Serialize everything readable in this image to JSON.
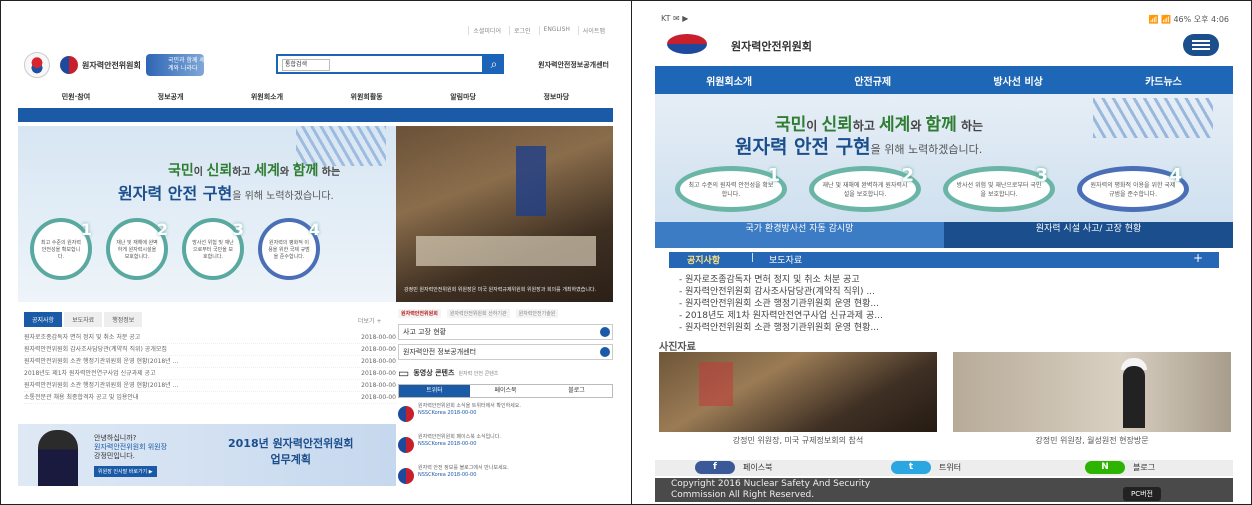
{
  "desktop": {
    "util_links": [
      "소셜미디어",
      "로그인",
      "ENGLISH",
      "사이트맵"
    ],
    "org_name": "원자력안전위원회",
    "slogan_logo": "국민과 함께 세계와 나라다",
    "search": {
      "select_value": "통합검색",
      "icon": "search-icon"
    },
    "side_link": "원자력안전정보공개센터",
    "gnb": [
      "민원·참여",
      "정보공개",
      "위원회소개",
      "위원회활동",
      "알림마당",
      "정보마당"
    ],
    "hero": {
      "line1_a": "국민",
      "line1_b": "이 ",
      "line1_c": "신뢰",
      "line1_d": "하고 ",
      "line1_e": "세계",
      "line1_f": "와 ",
      "line1_g": "함께",
      "line1_h": " 하는",
      "line2": "원자력 안전 구현",
      "line2_small": "을 위해 노력하겠습니다.",
      "circles": [
        {
          "num": "1",
          "text": "최고 수준의 원자력 안전성을 확보합니다."
        },
        {
          "num": "2",
          "text": "재난 및 재해에 완벽하게 원자력시설을 보호합니다."
        },
        {
          "num": "3",
          "text": "방사선 위험 및 재난으로부터 국민을 보호합니다."
        },
        {
          "num": "4",
          "text": "원자력의 평화적 이용을 위한 국제 규범을 준수합니다."
        }
      ]
    },
    "photo_caption": "강정민 원자력안전위원회 위원장은 미국 원자력규제위원회 위원장과 회의를 개최하였습니다.",
    "tabs": [
      "공지사항",
      "보도자료",
      "행정정보"
    ],
    "more": "더보기 +",
    "notices": [
      {
        "title": "원자로조종감독자 면허 정지 및 취소 처분 공고",
        "date": "2018-00-00"
      },
      {
        "title": "원자력안전위원회 감사조사담당관(계약직 직위) 공개모집",
        "date": "2018-00-00"
      },
      {
        "title": "원자력안전위원회 소관 행정기관위원회 운영 현황(2018년 ...",
        "date": "2018-00-00"
      },
      {
        "title": "2018년도 제1차 원자력안전연구사업 신규과제 공고",
        "date": "2018-00-00"
      },
      {
        "title": "원자력안전위원회 소관 행정기관위원회 운영 현황(2018년 ...",
        "date": "2018-00-00"
      },
      {
        "title": "소통전문관 채용 최종합격자 공고 및 임용안내",
        "date": "2018-00-00"
      }
    ],
    "banner": {
      "greet": [
        "안녕하십니까?",
        "원자력안전위원회 위원장",
        "강정민입니다."
      ],
      "btn": "위원장 인사말 바로가기 ▶",
      "title_1": "2018년 원자력안전위원회",
      "title_2": "업무계획"
    },
    "partners": [
      "원자력안전위원회",
      "원자력안전위원회 산하기관",
      "원자력안전기술원"
    ],
    "side_links": [
      "사고 고장 현황",
      "원자력안전 정보공개센터"
    ],
    "media": {
      "title": "동영상 콘텐츠",
      "sub": "원자력 안전 콘텐츠"
    },
    "sns_tabs": [
      "트위터",
      "페이스북",
      "블로그"
    ],
    "sns_items": [
      {
        "text": "원자력안전위원회 소식을 트위터에서 확인하세요.",
        "meta": "NSSCKorea 2018-00-00"
      },
      {
        "text": "원자력안전위원회 페이스북 소식입니다.",
        "meta": "NSSCKorea 2018-00-00"
      },
      {
        "text": "원자력 안전 정보를 블로그에서 만나보세요.",
        "meta": "NSSCKorea 2018-00-00"
      }
    ]
  },
  "mobile": {
    "status_left": "KT ✉ ▶",
    "status_right": "📶 📶 46% 오후 4:06",
    "title": "원자력안전위원회",
    "nav": [
      "위원회소개",
      "안전규제",
      "방사선 비상",
      "카드뉴스"
    ],
    "hero": {
      "line1_a": "국민",
      "line1_b": "이 ",
      "line1_c": "신뢰",
      "line1_d": "하고 ",
      "line1_e": "세계",
      "line1_f": "와 ",
      "line1_g": "함께",
      "line1_h": " 하는",
      "line2": "원자력 안전 구현",
      "line2_small": "을 위해 노력하겠습니다.",
      "ovals": [
        {
          "num": "1",
          "text": "최고 수준의 원자력 안전성을 확보합니다."
        },
        {
          "num": "2",
          "text": "재난 및 재해에 완벽하게 원자력시설을 보호합니다."
        },
        {
          "num": "3",
          "text": "방사선 위험 및 재난으로부터 국민을 보호합니다."
        },
        {
          "num": "4",
          "text": "원자력의 평화적 이용을 위한 국제 규범을 준수합니다."
        }
      ]
    },
    "split_a": "국가 환경방사선 자동 감시망",
    "split_b": "원자력 시설 사고/ 고장 현황",
    "tab_active": "공지사항",
    "tab_sep": "|",
    "tab_other": "보도자료",
    "tab_plus": "+",
    "list": [
      "원자로조종감독자 면허 정지 및 취소 처분 공고",
      "원자력안전위원회 감사조사담당관(계약직 직위) ...",
      "원자력안전위원회 소관 행정기관위원회 운영 현황...",
      "2018년도 제1차 원자력안전연구사업 신규과제 공...",
      "원자력안전위원회 소관 행정기관위원회 운영 현황..."
    ],
    "photo_title": "사진자료",
    "cap1": "강정민 위원장, 미국 규제정보회의 참석",
    "cap2": "강정민 위원장, 월성원전 현장방문",
    "sns": [
      {
        "icon": "f",
        "label": "페이스북"
      },
      {
        "icon": "t",
        "label": "트위터"
      },
      {
        "icon": "N",
        "label": "블로그"
      }
    ],
    "copyright_1": "Copyright 2016 Nuclear Safety And Security",
    "copyright_2": "Commission All Right Reserved.",
    "pc_btn": "PC버전",
    "colors": {
      "nav": "#1e66b6",
      "green": "#2e7d32",
      "navy": "#1b4e8c"
    }
  }
}
